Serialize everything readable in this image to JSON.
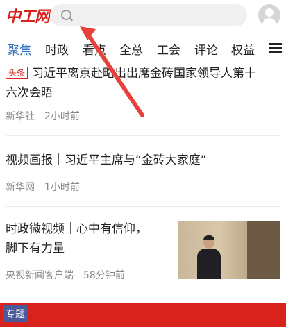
{
  "header": {
    "logo_text": "中工网",
    "search_placeholder": "",
    "icons": [
      "search-icon",
      "avatar-icon"
    ]
  },
  "tabs": [
    {
      "label": "聚焦",
      "active": true
    },
    {
      "label": "时政",
      "active": false
    },
    {
      "label": "看点",
      "active": false
    },
    {
      "label": "全总",
      "active": false
    },
    {
      "label": "工会",
      "active": false
    },
    {
      "label": "评论",
      "active": false
    },
    {
      "label": "权益",
      "active": false
    }
  ],
  "news": [
    {
      "tag": "头条",
      "title": "习近平离京赴塔出出席金砖国家领导人第十六次会晤",
      "title_line1": "习近平离京赴略出出席金砖国家领导人第十",
      "title_line2": "六次会晤",
      "source": "新华社",
      "time": "2小时前"
    },
    {
      "title": "视频画报｜习近平主席与“金砖大家庭”",
      "source": "新华网",
      "time": "1小时前"
    },
    {
      "title_line1": "时政微视频｜心中有信仰，",
      "title_line2": "脚下有力量",
      "source": "央视新闻客户端",
      "time": "58分钟前"
    }
  ],
  "banner": {
    "label": "专题"
  },
  "colors": {
    "brand_red": "#d8221b",
    "active_tab": "#2f6fbf",
    "meta_gray": "#8a8a8a",
    "annotation_arrow": "#e8403a"
  }
}
